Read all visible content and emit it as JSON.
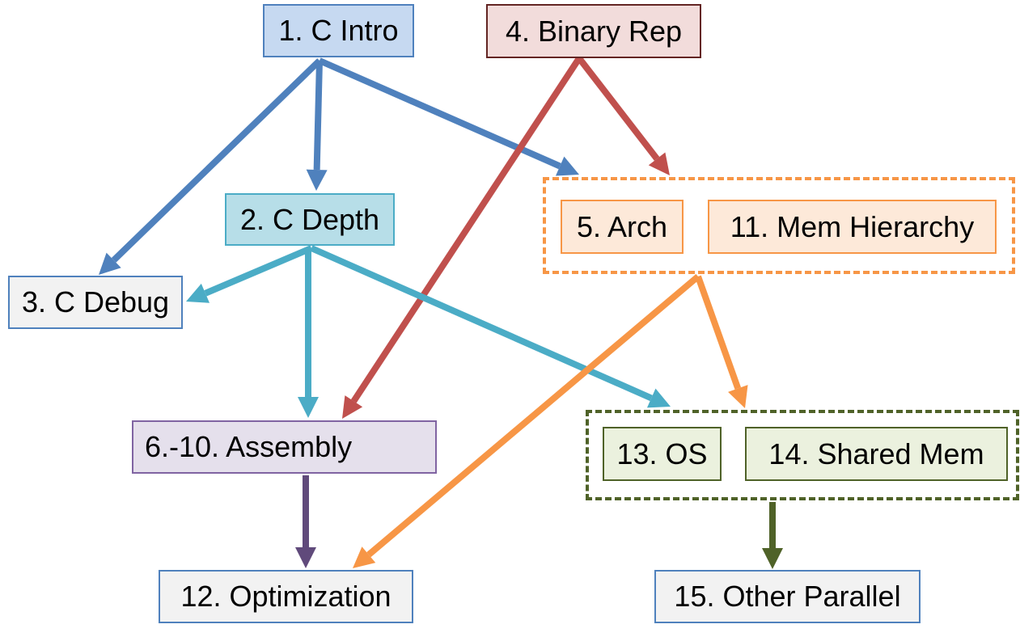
{
  "diagram": {
    "nodes": {
      "c_intro": {
        "label": "1. C Intro",
        "fill": "#c6d9f1",
        "stroke": "#4f81bd"
      },
      "c_depth": {
        "label": "2. C Depth",
        "fill": "#b7dee8",
        "stroke": "#4bacc6"
      },
      "c_debug": {
        "label": "3. C Debug",
        "fill": "#f2f2f2",
        "stroke": "#4f81bd"
      },
      "binary_rep": {
        "label": "4. Binary Rep",
        "fill": "#f2dcdb",
        "stroke": "#632523"
      },
      "arch": {
        "label": "5. Arch",
        "fill": "#fde9d9",
        "stroke": "#f79646"
      },
      "mem_hierarchy": {
        "label": "11. Mem Hierarchy",
        "fill": "#fde9d9",
        "stroke": "#f79646"
      },
      "assembly": {
        "label": "6.-10.  Assembly",
        "fill": "#e5e0ec",
        "stroke": "#8064a2"
      },
      "optimization": {
        "label": "12. Optimization",
        "fill": "#f2f2f2",
        "stroke": "#4f81bd"
      },
      "os": {
        "label": "13. OS",
        "fill": "#ebf1de",
        "stroke": "#4f6228"
      },
      "shared_mem": {
        "label": "14. Shared Mem",
        "fill": "#ebf1de",
        "stroke": "#4f6228"
      },
      "other_parallel": {
        "label": "15. Other Parallel",
        "fill": "#f2f2f2",
        "stroke": "#4f81bd"
      }
    },
    "groups": {
      "arch_mem_group": {
        "members": [
          "arch",
          "mem_hierarchy"
        ],
        "stroke": "#f79646"
      },
      "os_shared_group": {
        "members": [
          "os",
          "shared_mem"
        ],
        "stroke": "#4f6228"
      }
    },
    "edges": [
      {
        "from": "c_intro",
        "to": "c_debug",
        "color": "#4f81bd"
      },
      {
        "from": "c_intro",
        "to": "c_depth",
        "color": "#4f81bd"
      },
      {
        "from": "c_intro",
        "to": "arch_mem_group",
        "color": "#4f81bd"
      },
      {
        "from": "binary_rep",
        "to": "arch_mem_group",
        "color": "#c0504d"
      },
      {
        "from": "binary_rep",
        "to": "assembly",
        "color": "#c0504d"
      },
      {
        "from": "c_depth",
        "to": "c_debug",
        "color": "#4bacc6"
      },
      {
        "from": "c_depth",
        "to": "assembly",
        "color": "#4bacc6"
      },
      {
        "from": "c_depth",
        "to": "os_shared_group",
        "color": "#4bacc6"
      },
      {
        "from": "arch_mem_group",
        "to": "optimization",
        "color": "#f79646"
      },
      {
        "from": "arch_mem_group",
        "to": "os_shared_group",
        "color": "#f79646"
      },
      {
        "from": "assembly",
        "to": "optimization",
        "color": "#604a7b"
      },
      {
        "from": "os_shared_group",
        "to": "other_parallel",
        "color": "#4f6228"
      }
    ]
  }
}
